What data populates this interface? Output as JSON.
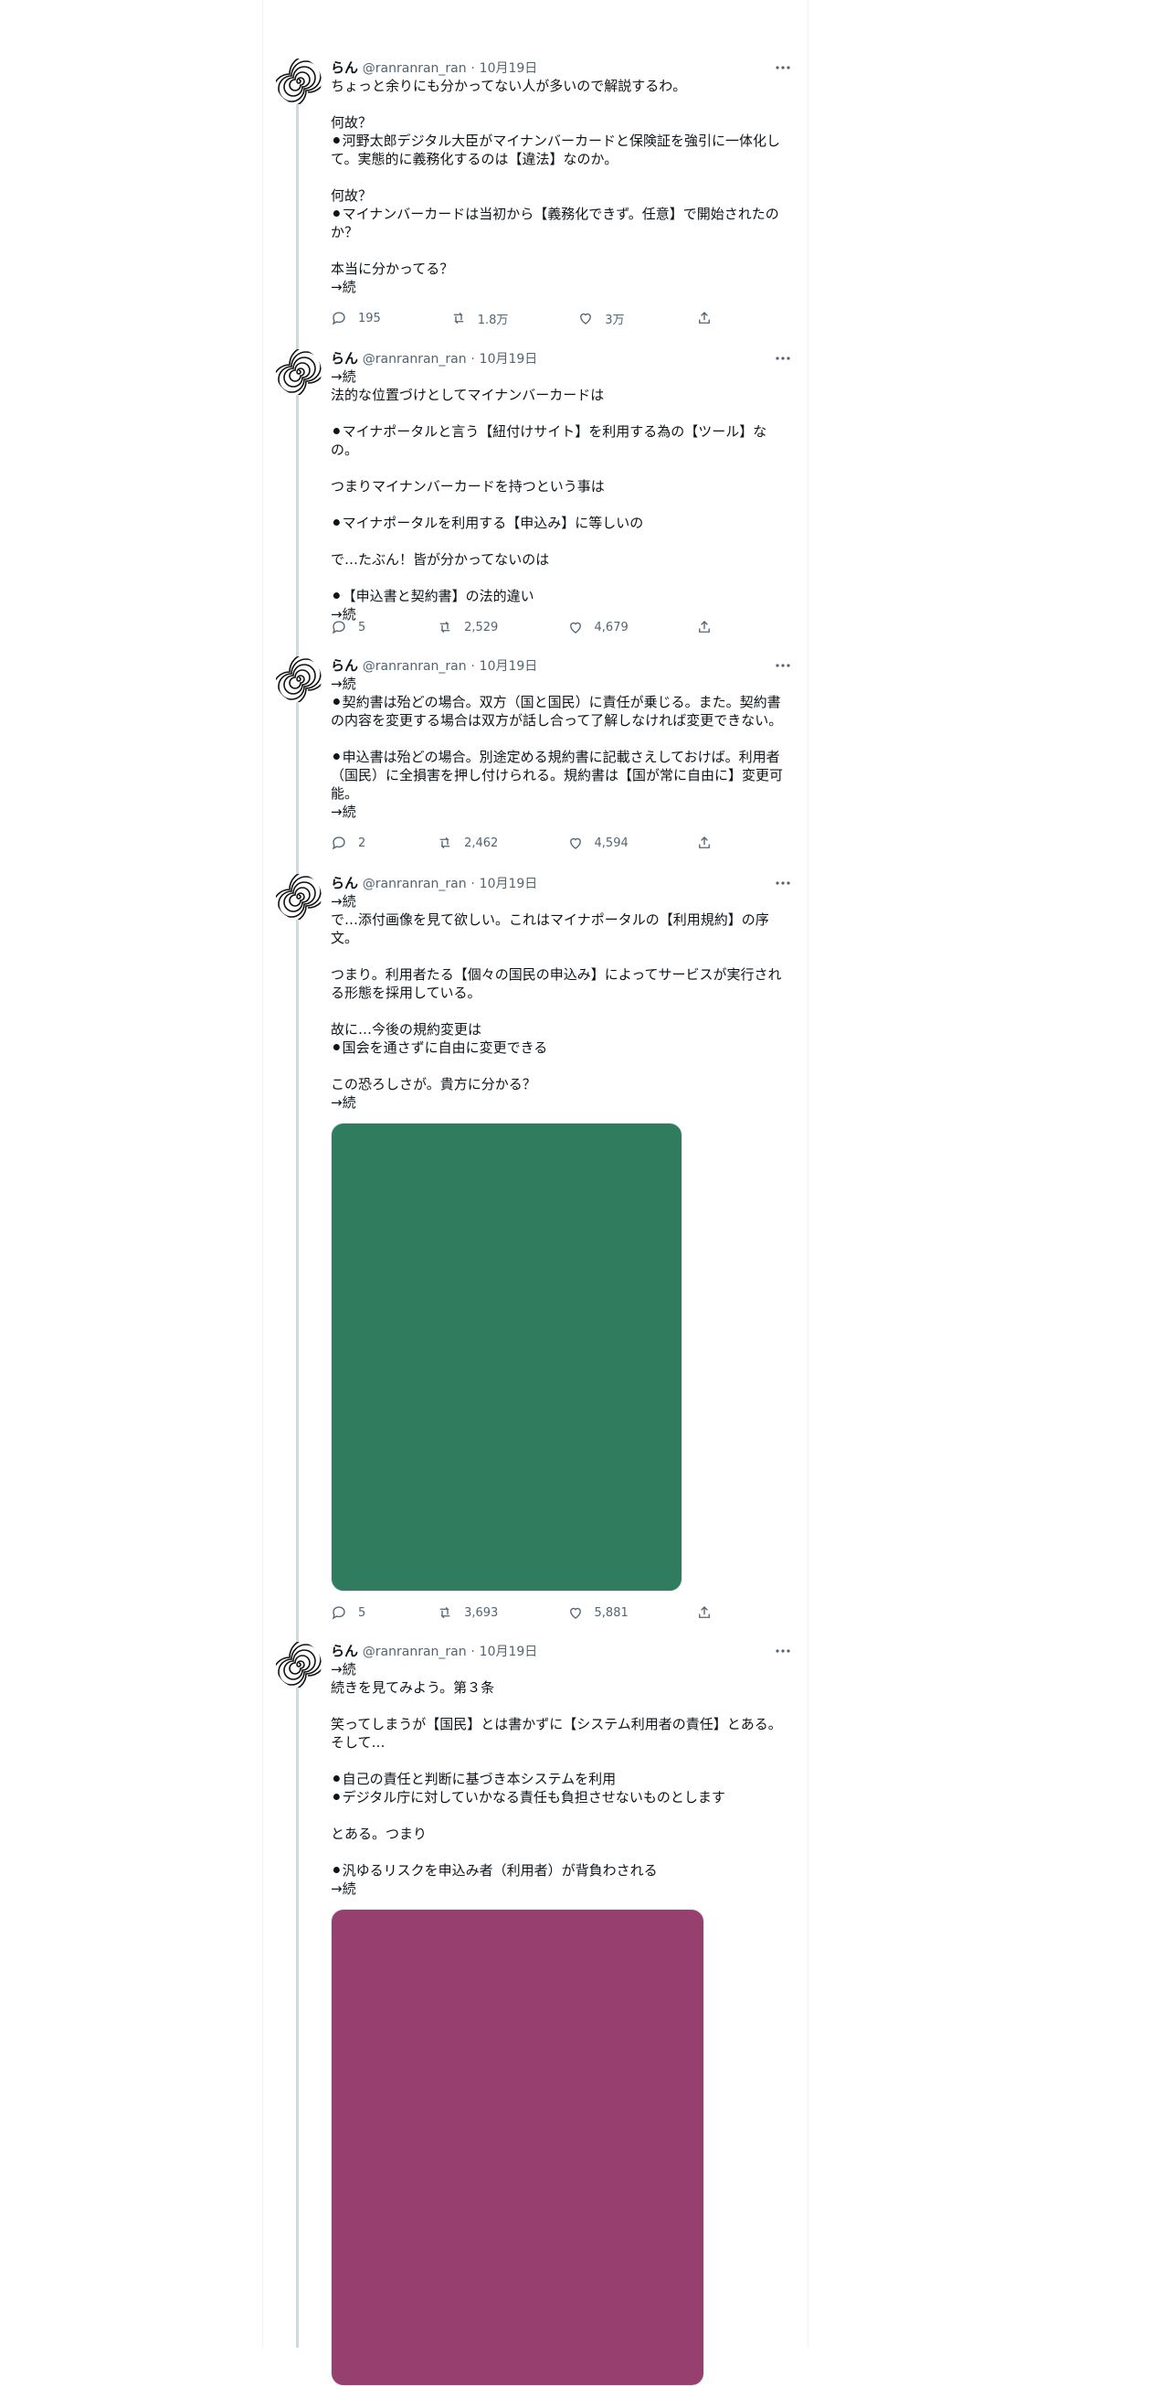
{
  "author": {
    "name": "らん",
    "handle": "@ranranran_ran",
    "separator": "·"
  },
  "tweets": [
    {
      "date": "10月19日",
      "text": "ちょっと余りにも分かってない人が多いので解説するわ。\n\n何故？\n⚫︎河野太郎デジタル大臣がマイナンバーカードと保険証を強引に一体化して。実態的に義務化するのは【違法】なのか。\n\n何故？\n⚫︎マイナンバーカードは当初から【義務化できず。任意】で開始されたのか？\n\n本当に分かってる？\n→続",
      "replies": "195",
      "retweets": "1.8万",
      "likes": "3万"
    },
    {
      "date": "10月19日",
      "text": "→続\n法的な位置づけとしてマイナンバーカードは\n\n⚫︎マイナポータルと言う【紐付けサイト】を利用する為の【ツール】なの。\n\nつまりマイナンバーカードを持つという事は\n\n⚫︎マイナポータルを利用する【申込み】に等しいの\n\nで…たぶん！皆が分かってないのは\n\n⚫︎【申込書と契約書】の法的違い\n→続",
      "replies": "5",
      "retweets": "2,529",
      "likes": "4,679"
    },
    {
      "date": "10月19日",
      "text": "→続\n⚫︎契約書は殆どの場合。双方（国と国民）に責任が乗じる。また。契約書の内容を変更する場合は双方が話し合って了解しなければ変更できない。\n\n⚫︎申込書は殆どの場合。別途定める規約書に記載さえしておけば。利用者（国民）に全損害を押し付けられる。規約書は【国が常に自由に】変更可能。\n→続",
      "replies": "2",
      "retweets": "2,462",
      "likes": "4,594"
    },
    {
      "date": "10月19日",
      "text": "→続\nで…添付画像を見て欲しい。これはマイナポータルの【利用規約】の序文。\n\nつまり。利用者たる【個々の国民の申込み】によってサービスが実行される形態を採用している。\n\n故に…今後の規約変更は\n⚫︎国会を通さずに自由に変更できる\n\nこの恐ろしさが。貴方に分かる？\n→続",
      "replies": "5",
      "retweets": "3,693",
      "likes": "5,881",
      "media_color": "#2f7d5e"
    },
    {
      "date": "10月19日",
      "text": "→続\n続きを見てみよう。第３条\n\n笑ってしまうが【国民】とは書かずに【システム利用者の責任】とある。そして…\n\n⚫︎自己の責任と判断に基づき本システムを利用\n⚫︎デジタル庁に対していかなる責任も負担させないものとします\n\nとある。つまり\n\n⚫︎汎ゆるリスクを申込み者（利用者）が背負わされる\n→続",
      "media_color": "#97406f"
    }
  ]
}
